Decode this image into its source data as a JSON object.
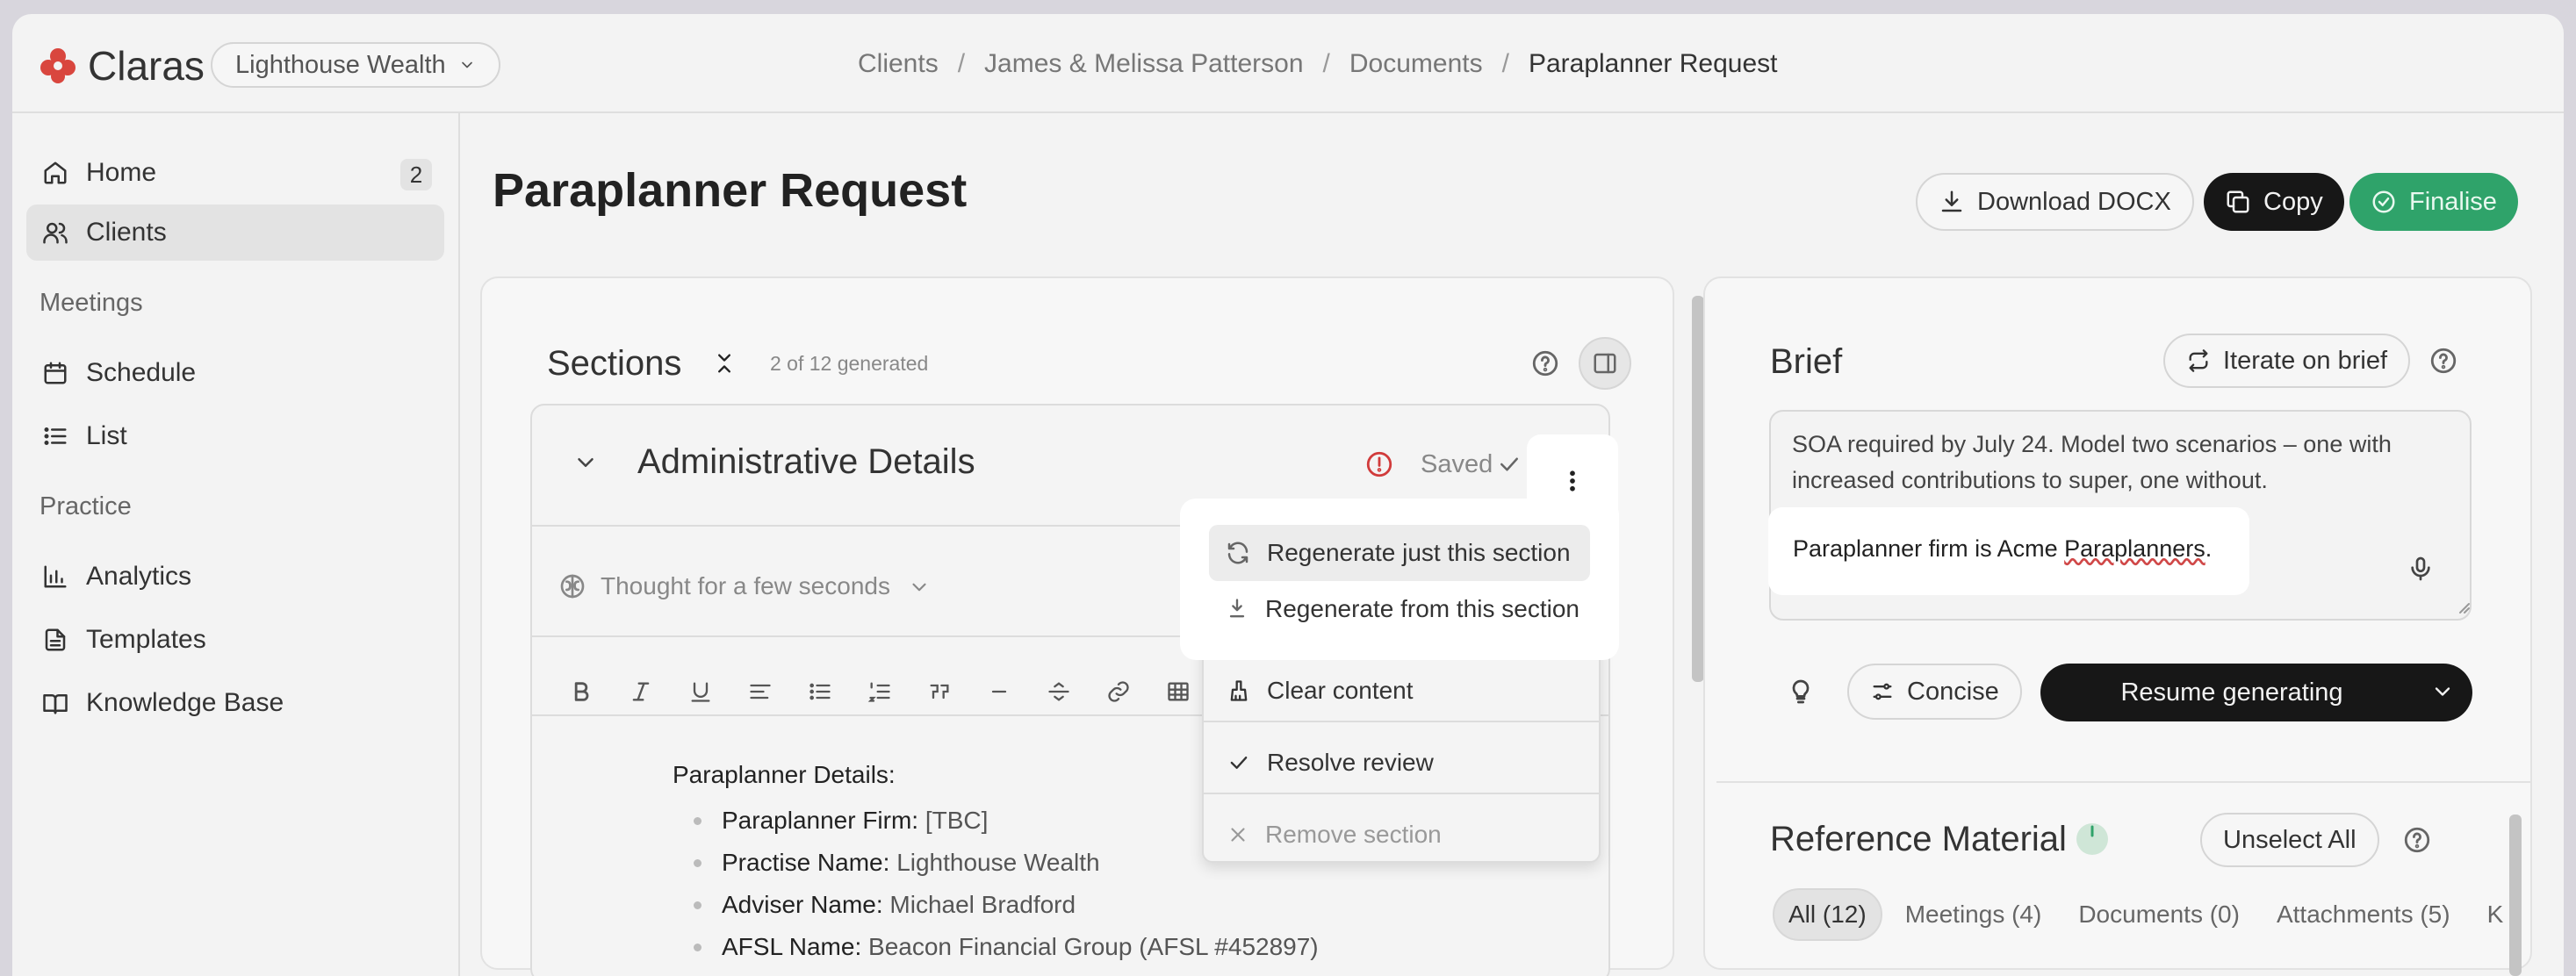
{
  "app": {
    "brand": "Claras",
    "brand_color": "#d9463e",
    "org": "Lighthouse Wealth"
  },
  "breadcrumb": [
    "Clients",
    "James & Melissa Patterson",
    "Documents",
    "Paraplanner Request"
  ],
  "sidebar": {
    "home": {
      "label": "Home",
      "badge": "2"
    },
    "clients": {
      "label": "Clients"
    },
    "meetings_heading": "Meetings",
    "schedule": {
      "label": "Schedule"
    },
    "list": {
      "label": "List"
    },
    "practice_heading": "Practice",
    "analytics": {
      "label": "Analytics"
    },
    "templates": {
      "label": "Templates"
    },
    "knowledge_base": {
      "label": "Knowledge Base"
    }
  },
  "page": {
    "title": "Paraplanner Request",
    "download_label": "Download DOCX",
    "copy_label": "Copy",
    "finalise_label": "Finalise"
  },
  "sections": {
    "title": "Sections",
    "generated_count": "2 of 12 generated",
    "card": {
      "title": "Administrative Details",
      "status": "Saved",
      "thought": "Thought for a few seconds"
    },
    "content": {
      "heading": "Paraplanner Details:",
      "fields": [
        {
          "label": "Paraplanner Firm:",
          "value": "[TBC]"
        },
        {
          "label": "Practise Name:",
          "value": "Lighthouse Wealth"
        },
        {
          "label": "Adviser Name:",
          "value": "Michael Bradford"
        },
        {
          "label": "AFSL Name:",
          "value": "Beacon Financial Group (AFSL #452897)"
        }
      ]
    }
  },
  "menu": {
    "regenerate_just": "Regenerate just this section",
    "regenerate_from": "Regenerate from this section",
    "clear": "Clear content",
    "resolve": "Resolve review",
    "remove": "Remove section"
  },
  "brief": {
    "title": "Brief",
    "iterate_label": "Iterate on brief",
    "text": "SOA required by July 24. Model two scenarios – one with increased contributions to super, one without.",
    "note_prefix": "Paraplanner firm is Acme ",
    "note_underlined": "Paraplanners",
    "note_suffix": ".",
    "concise_label": "Concise",
    "resume_label": "Resume generating"
  },
  "reference": {
    "title": "Reference Material",
    "unselect_label": "Unselect All",
    "tabs": [
      "All (12)",
      "Meetings (4)",
      "Documents (0)",
      "Attachments (5)",
      "K"
    ]
  },
  "colors": {
    "accent_green": "#2fa36a",
    "dark_button": "#171717",
    "warning_red": "#d13b3b"
  }
}
